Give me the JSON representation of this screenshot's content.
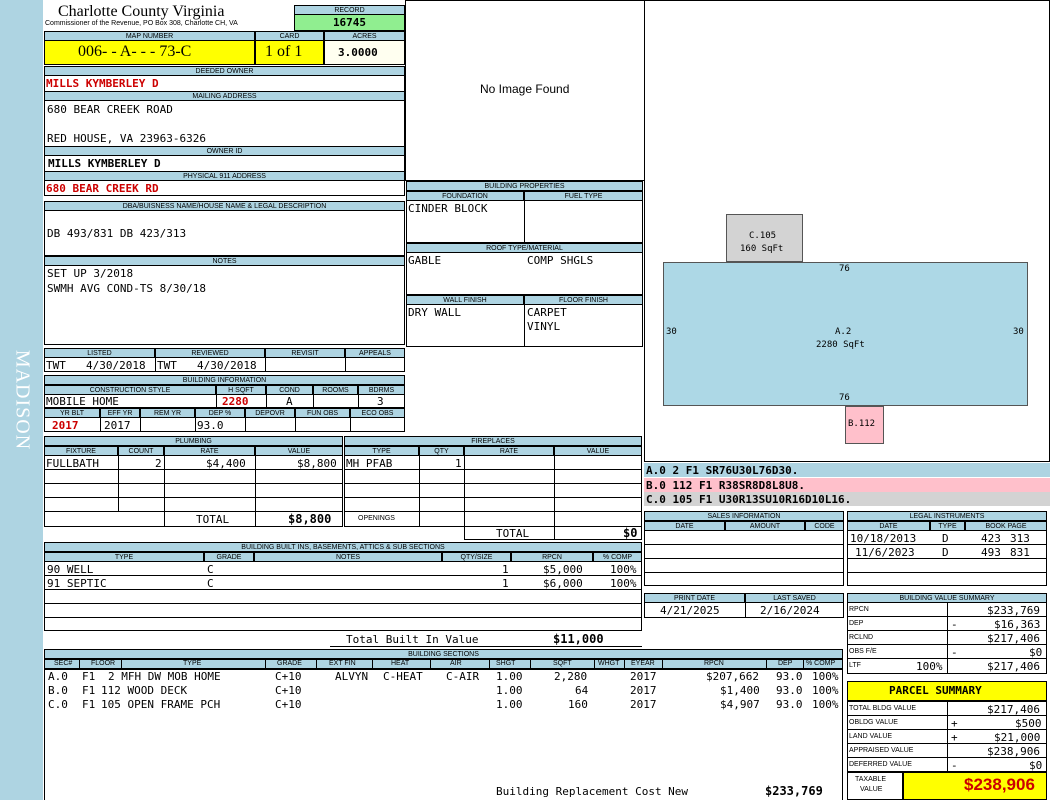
{
  "side_label": "MADISON",
  "header": {
    "county": "Charlotte County Virginia",
    "commissioner": "Commissioner of the Revenue, PO Box 308, Charlotte CH, VA",
    "record_label": "RECORD",
    "record": "16745",
    "map_label": "MAP NUMBER",
    "map_number": "006-  - A-   -   - 73-C",
    "card_label": "CARD",
    "card": "1 of 1",
    "acres_label": "ACRES",
    "acres": "3.0000"
  },
  "owner": {
    "deeded_label": "DEEDED OWNER",
    "deeded_owner": "MILLS KYMBERLEY D",
    "mailing_label": "MAILING ADDRESS",
    "mailing_line1": "680 BEAR CREEK ROAD",
    "mailing_line2": "RED HOUSE, VA 23963-6326",
    "owner_id_label": "OWNER ID",
    "owner_id": "MILLS KYMBERLEY D",
    "physical_label": "PHYSICAL 911 ADDRESS",
    "physical_address": "680 BEAR CREEK RD",
    "dba_label": "DBA/BUISNESS NAME/HOUSE NAME & LEGAL DESCRIPTION",
    "legal_desc": "DB 493/831 DB 423/313",
    "notes_label": "NOTES",
    "notes": [
      "SET UP 3/2018",
      "SWMH AVG COND-TS 8/30/18"
    ]
  },
  "image_placeholder": "No Image Found",
  "dates": {
    "listed_label": "LISTED",
    "reviewed_label": "REVIEWED",
    "revisit_label": "REVISIT",
    "appeals_label": "APPEALS",
    "listed_by": "TWT",
    "listed_date": "4/30/2018",
    "reviewed_by": "TWT",
    "reviewed_date": "4/30/2018"
  },
  "building_info": {
    "title": "BUILDING INFORMATION",
    "style_label": "CONSTRUCTION STYLE",
    "hsqft_label": "H SQFT",
    "cond_label": "COND",
    "rooms_label": "ROOMS",
    "bdrms_label": "BDRMS",
    "style": "MOBILE HOME",
    "hsqft": "2280",
    "cond": "A",
    "bdrms": "3",
    "yrblt_label": "YR BLT",
    "effyr_label": "EFF YR",
    "remyr_label": "REM YR",
    "deppct_label": "DEP %",
    "depovr_label": "DEPOVR",
    "funobs_label": "FUN OBS",
    "ecoobs_label": "ECO OBS",
    "yrblt": "2017",
    "effyr": "2017",
    "deppct": "93.0"
  },
  "building_props": {
    "title": "BUILDING PROPERTIES",
    "foundation_label": "FOUNDATION",
    "fuel_label": "FUEL TYPE",
    "foundation": "CINDER BLOCK",
    "roof_label": "ROOF TYPE/MATERIAL",
    "roof_type": "GABLE",
    "roof_material": "COMP SHGLS",
    "wall_label": "WALL FINISH",
    "floor_label": "FLOOR FINISH",
    "wall": "DRY WALL",
    "floor1": "CARPET",
    "floor2": "VINYL"
  },
  "sketch": {
    "c_label": "C.105",
    "c_area": "160 SqFt",
    "a_label": "A.2",
    "a_area": "2280 SqFt",
    "b_label": "B.112",
    "top_dim": "76",
    "bottom_dim": "76",
    "left_dim": "30",
    "right_dim": "30"
  },
  "sketch_legend": [
    {
      "text": "A.0  2    F1  SR76U30L76D30.",
      "bg": "#aed4e2"
    },
    {
      "text": "B.0  112  F1  R38SR8D8L8U8.",
      "bg": "#ffc0cb"
    },
    {
      "text": "C.0  105  F1  U30R13SU10R16D10L16.",
      "bg": "#d3d3d3"
    }
  ],
  "plumbing": {
    "title": "PLUMBING",
    "fixture_label": "FIXTURE",
    "count_label": "COUNT",
    "rate_label": "RATE",
    "value_label": "VALUE",
    "fixture": "FULLBATH",
    "count": "2",
    "rate": "$4,400",
    "value": "$8,800",
    "total_label": "TOTAL",
    "total": "$8,800"
  },
  "fireplaces": {
    "title": "FIREPLACES",
    "type_label": "TYPE",
    "qty_label": "QTY",
    "rate_label": "RATE",
    "value_label": "VALUE",
    "type": "MH PFAB",
    "qty": "1",
    "openings_label": "OPENINGS",
    "total_label": "TOTAL",
    "total": "$0"
  },
  "sales": {
    "title": "SALES INFORMATION",
    "date_label": "DATE",
    "amount_label": "AMOUNT",
    "code_label": "CODE"
  },
  "legal": {
    "title": "LEGAL INSTRUMENTS",
    "date_label": "DATE",
    "type_label": "TYPE",
    "bookpage_label": "BOOK PAGE",
    "rows": [
      {
        "date": "10/18/2013",
        "type": "D",
        "book": "423",
        "page": "313"
      },
      {
        "date": "11/6/2023",
        "type": "D",
        "book": "493",
        "page": "831"
      }
    ]
  },
  "builtins": {
    "title": "BUILDING BUILT INS, BASEMENTS, ATTICS & SUB SECTIONS",
    "type_label": "TYPE",
    "grade_label": "GRADE",
    "notes_label": "NOTES",
    "qty_label": "QTY/SIZE",
    "rpcn_label": "RPCN",
    "comp_label": "% COMP",
    "rows": [
      {
        "type": "90 WELL",
        "grade": "C",
        "qty": "1",
        "rpcn": "$5,000",
        "comp": "100%"
      },
      {
        "type": "91 SEPTIC",
        "grade": "C",
        "qty": "1",
        "rpcn": "$6,000",
        "comp": "100%"
      }
    ],
    "total_label": "Total Built In Value",
    "total": "$11,000"
  },
  "print": {
    "print_label": "PRINT DATE",
    "saved_label": "LAST SAVED",
    "print_date": "4/21/2025",
    "saved_date": "2/16/2024"
  },
  "value_summary": {
    "title": "BUILDING VALUE SUMMARY",
    "rows": [
      {
        "label": "RPCN",
        "sign": "",
        "value": "$233,769",
        "pct": ""
      },
      {
        "label": "DEP",
        "sign": "-",
        "value": "$16,363",
        "pct": ""
      },
      {
        "label": "RCLND",
        "sign": "",
        "value": "$217,406",
        "pct": ""
      },
      {
        "label": "OBS F/E",
        "sign": "-",
        "value": "$0",
        "pct": ""
      },
      {
        "label": "LTF",
        "sign": "",
        "value": "$217,406",
        "pct": "100%"
      }
    ]
  },
  "parcel": {
    "title": "PARCEL SUMMARY",
    "rows": [
      {
        "label": "TOTAL BLDG VALUE",
        "sign": "",
        "value": "$217,406"
      },
      {
        "label": "OBLDG VALUE",
        "sign": "+",
        "value": "$500"
      },
      {
        "label": "LAND VALUE",
        "sign": "+",
        "value": "$21,000"
      },
      {
        "label": "APPRAISED VALUE",
        "sign": "",
        "value": "$238,906"
      },
      {
        "label": "DEFERRED VALUE",
        "sign": "-",
        "value": "$0"
      }
    ],
    "taxable_label_1": "TAXABLE",
    "taxable_label_2": "VALUE",
    "taxable": "$238,906"
  },
  "sections": {
    "title": "BUILDING SECTIONS",
    "headers": {
      "sec": "SEC#",
      "floor": "FLOOR",
      "type": "TYPE",
      "grade": "GRADE",
      "extfin": "EXT FIN",
      "heat": "HEAT",
      "air": "AIR",
      "shgt": "SHGT",
      "sqft": "SQFT",
      "whgt": "WHGT",
      "eyear": "EYEAR",
      "rpcn": "RPCN",
      "dep": "DEP",
      "comp": "% COMP"
    },
    "rows": [
      {
        "sec": "A.0",
        "floor": "F1",
        "type": "2 MFH DW MOB HOME",
        "grade": "C+10",
        "extfin": "ALVYN",
        "heat": "C-HEAT",
        "air": "C-AIR",
        "shgt": "1.00",
        "sqft": "2,280",
        "eyear": "2017",
        "rpcn": "$207,662",
        "dep": "93.0",
        "comp": "100%"
      },
      {
        "sec": "B.0",
        "floor": "F1",
        "type": "112 WOOD DECK",
        "grade": "C+10",
        "extfin": "",
        "heat": "",
        "air": "",
        "shgt": "1.00",
        "sqft": "64",
        "eyear": "2017",
        "rpcn": "$1,400",
        "dep": "93.0",
        "comp": "100%"
      },
      {
        "sec": "C.0",
        "floor": "F1",
        "type": "105 OPEN FRAME PCH",
        "grade": "C+10",
        "extfin": "",
        "heat": "",
        "air": "",
        "shgt": "1.00",
        "sqft": "160",
        "eyear": "2017",
        "rpcn": "$4,907",
        "dep": "93.0",
        "comp": "100%"
      }
    ],
    "replacement_label": "Building Replacement Cost New",
    "replacement": "$233,769"
  }
}
